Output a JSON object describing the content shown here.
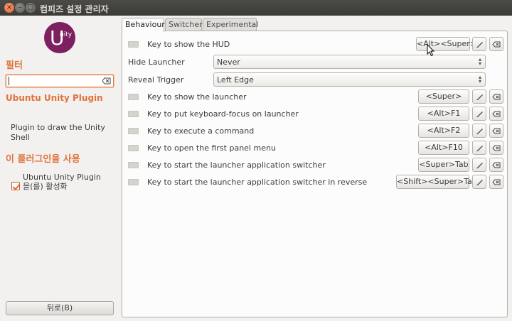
{
  "window": {
    "title": "컴피즈 설정 관리자",
    "close_glyph": "×",
    "min_glyph": "–",
    "max_glyph": "□"
  },
  "sidebar": {
    "logo_letter": "U",
    "logo_text": "nity",
    "filter_heading": "필터",
    "filter_value": "",
    "plugin_name": "Ubuntu Unity Plugin",
    "plugin_description": "Plugin to draw the Unity Shell",
    "enable_heading": "이 플러그인을 사용",
    "enable_label": "Ubuntu Unity Plugin을(를) 활성화",
    "enable_checked": true,
    "back_label": "뒤로(B)"
  },
  "tabs": [
    {
      "label": "Behaviour",
      "active": true
    },
    {
      "label": "Switcher",
      "active": false
    },
    {
      "label": "Experimental",
      "active": false
    }
  ],
  "settings": {
    "show_hud": {
      "label": "Key to show the HUD",
      "binding": "<Alt><Super>"
    },
    "hide_launcher": {
      "label": "Hide Launcher",
      "value": "Never"
    },
    "reveal_trigger": {
      "label": "Reveal Trigger",
      "value": "Left Edge"
    },
    "show_launcher": {
      "label": "Key to show the launcher",
      "binding": "<Super>"
    },
    "focus_launcher": {
      "label": "Key to put keyboard-focus on launcher",
      "binding": "<Alt>F1"
    },
    "execute_command": {
      "label": "Key to execute a command",
      "binding": "<Alt>F2"
    },
    "panel_menu": {
      "label": "Key to open the first panel menu",
      "binding": "<Alt>F10"
    },
    "app_switcher": {
      "label": "Key to start the launcher application switcher",
      "binding": "<Super>Tab"
    },
    "app_switcher_reverse": {
      "label": "Key to start the launcher application switcher in reverse",
      "binding": "<Shift><Super>Tab"
    }
  },
  "icons": {
    "key": "keyboard-key-icon",
    "edit": "pencil-icon",
    "reset": "clear-icon",
    "combo": "updown-arrow-icon"
  },
  "colors": {
    "accent": "#e0733c",
    "titlebar": "#3c3b37",
    "logo": "#7c2060"
  }
}
